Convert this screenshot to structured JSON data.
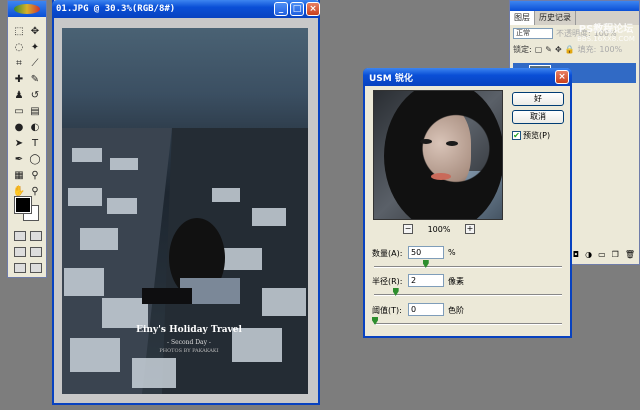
{
  "document": {
    "title": "01.JPG @ 30.3%(RGB/8#)",
    "caption_line1": "Einy's Holiday Travel",
    "caption_line2": "- Second Day -",
    "caption_line3": "PHOTOS BY PAKAKAKI"
  },
  "layers_panel": {
    "tabs": [
      "图层",
      "历史记录"
    ],
    "blend_mode": "正常",
    "opacity_label": "不透明度:",
    "opacity_value": "100%",
    "lock_label": "锁定:",
    "fill_label": "填充:",
    "fill_value": "100%",
    "layer_name": "背景"
  },
  "usm_dialog": {
    "title": "USM 锐化",
    "ok_label": "好",
    "cancel_label": "取消",
    "preview_label": "预览(P)",
    "preview_checked": true,
    "zoom_value": "100%",
    "zoom_minus": "−",
    "zoom_plus": "+",
    "amount": {
      "label": "数量(A):",
      "value": "50",
      "unit": "%",
      "slider_fraction": 0.27
    },
    "radius": {
      "label": "半径(R):",
      "value": "2",
      "unit": "像素",
      "slider_fraction": 0.11
    },
    "threshold": {
      "label": "阈值(T):",
      "value": "0",
      "unit": "色阶",
      "slider_fraction": 0.0
    }
  },
  "watermark": {
    "line1": "PS教程论坛",
    "line2": "BBS.16XX8.COM"
  },
  "colors": {
    "titlebar": "#0a4fd6",
    "window_bg": "#ece9d8",
    "workspace": "#7d7d7d"
  }
}
